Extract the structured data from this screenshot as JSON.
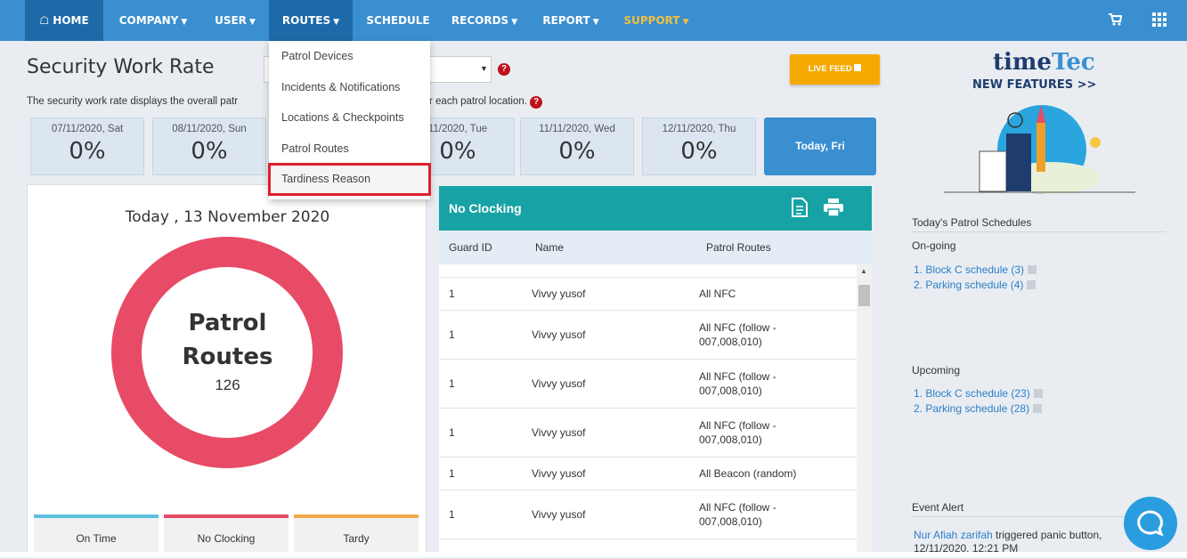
{
  "nav": {
    "home": "HOME",
    "company": "COMPANY",
    "user": "USER",
    "routes": "ROUTES",
    "schedule": "SCHEDULE",
    "records": "RECORDS",
    "report": "REPORT",
    "support": "SUPPORT"
  },
  "routes_menu": [
    "Patrol Devices",
    "Incidents & Notifications",
    "Locations & Checkpoints",
    "Patrol Routes",
    "Tardiness Reason"
  ],
  "page": {
    "title": "Security Work Rate",
    "subtitle_left": "The security work rate displays the overall patr",
    "subtitle_right": "r each patrol location.",
    "live_feed": "LIVE FEED"
  },
  "days": [
    {
      "date": "07/11/2020, Sat",
      "pct": "0%"
    },
    {
      "date": "08/11/2020, Sun",
      "pct": "0%"
    },
    {
      "date": "11/2020, Tue",
      "pct": "0%"
    },
    {
      "date": "11/11/2020, Wed",
      "pct": "0%"
    },
    {
      "date": "12/11/2020, Thu",
      "pct": "0%"
    }
  ],
  "today_label": "Today, Fri",
  "summary": {
    "date": "Today , 13 November 2020",
    "line1": "Patrol",
    "line2": "Routes",
    "count": "126",
    "ring_color": "#e84b66",
    "tabs": [
      {
        "label": "On Time",
        "color": "#5bc0de"
      },
      {
        "label": "No Clocking",
        "color": "#e84b66"
      },
      {
        "label": "Tardy",
        "color": "#f5a94a"
      }
    ]
  },
  "no_clocking": {
    "title": "No Clocking",
    "columns": [
      "Guard ID",
      "Name",
      "Patrol Routes"
    ],
    "rows": [
      {
        "id": "1",
        "name": "Vivvy yusof",
        "route": [
          "All NFC"
        ]
      },
      {
        "id": "1",
        "name": "Vivvy yusof",
        "route": [
          "All NFC (follow -",
          "007,008,010)"
        ]
      },
      {
        "id": "1",
        "name": "Vivvy yusof",
        "route": [
          "All NFC (follow -",
          "007,008,010)"
        ]
      },
      {
        "id": "1",
        "name": "Vivvy yusof",
        "route": [
          "All NFC (follow -",
          "007,008,010)"
        ]
      },
      {
        "id": "1",
        "name": "Vivvy yusof",
        "route": [
          "All Beacon (random)"
        ]
      },
      {
        "id": "1",
        "name": "Vivvy yusof",
        "route": [
          "All NFC (follow -",
          "007,008,010)"
        ]
      }
    ]
  },
  "sidebar": {
    "logo_time": "time",
    "logo_tec": "Tec",
    "new_features": "NEW FEATURES >>",
    "schedules_title": "Today's Patrol Schedules",
    "ongoing": "On-going",
    "ongoing_items": [
      "1. Block C schedule (3)",
      "2. Parking schedule (4)"
    ],
    "upcoming": "Upcoming",
    "upcoming_items": [
      "1. Block C schedule (23)",
      "2. Parking schedule (28)"
    ],
    "event_alert": "Event Alert",
    "event_name": "Nur Afiah zarifah",
    "event_text": " triggered panic button,",
    "event_time": "12/11/2020, 12:21 PM"
  }
}
